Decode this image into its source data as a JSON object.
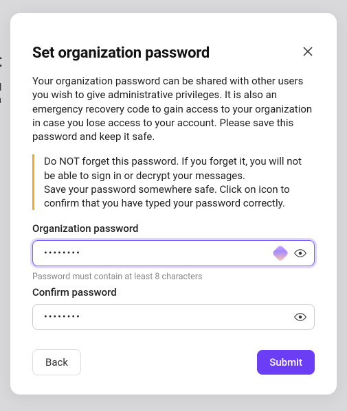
{
  "backdrop": {
    "fragment1": "t",
    "fragment2": "d a"
  },
  "modal": {
    "title": "Set organization password",
    "description": "Your organization password can be shared with other users you wish to give administrative privileges. It is also an emergency recovery code to gain access to your organization in case you lose access to your account. Please save this password and keep it safe.",
    "callout": {
      "line1": "Do NOT forget this password. If you forget it, you will not be able to sign in or decrypt your messages.",
      "line2": "Save your password somewhere safe. Click on icon to confirm that you have typed your password correctly."
    },
    "fields": {
      "org_password": {
        "label": "Organization password",
        "value": "••••••••",
        "hint": "Password must contain at least 8 characters"
      },
      "confirm_password": {
        "label": "Confirm password",
        "value": "••••••••"
      }
    },
    "buttons": {
      "back": "Back",
      "submit": "Submit"
    }
  }
}
